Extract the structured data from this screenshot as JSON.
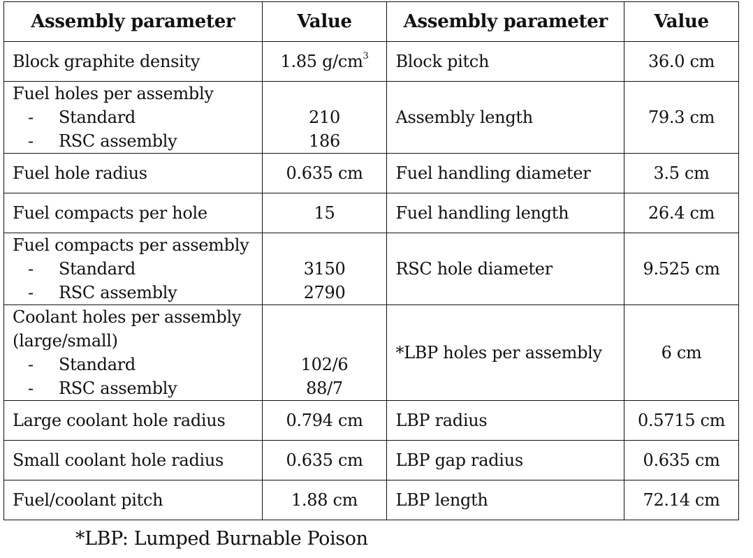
{
  "table": {
    "headers": [
      "Assembly parameter",
      "Value",
      "Assembly parameter",
      "Value"
    ],
    "rows": [
      {
        "left": {
          "param": "Block graphite density",
          "value": "1.85 g/cm",
          "value_sup": "3"
        },
        "right": {
          "param": "Block pitch",
          "value": "36.0 cm"
        }
      },
      {
        "left": {
          "param": "Fuel holes per assembly",
          "sub": [
            {
              "dash": "-",
              "label": "Standard",
              "value": "210"
            },
            {
              "dash": "-",
              "label": "RSC assembly",
              "value": "186"
            }
          ]
        },
        "right": {
          "param": "Assembly length",
          "value": "79.3 cm"
        }
      },
      {
        "left": {
          "param": "Fuel hole radius",
          "value": "0.635 cm"
        },
        "right": {
          "param": "Fuel handling diameter",
          "value": "3.5 cm"
        }
      },
      {
        "left": {
          "param": "Fuel compacts per hole",
          "value": "15"
        },
        "right": {
          "param": "Fuel handling length",
          "value": "26.4 cm"
        }
      },
      {
        "left": {
          "param": "Fuel compacts per assembly",
          "sub": [
            {
              "dash": "-",
              "label": "Standard",
              "value": "3150"
            },
            {
              "dash": "-",
              "label": "RSC assembly",
              "value": "2790"
            }
          ]
        },
        "right": {
          "param": "RSC hole diameter",
          "value": "9.525 cm"
        }
      },
      {
        "left": {
          "param": "Coolant holes per assembly",
          "param_line2": "(large/small)",
          "sub": [
            {
              "dash": "-",
              "label": "Standard",
              "value": "102/6"
            },
            {
              "dash": "-",
              "label": "RSC assembly",
              "value": "88/7"
            }
          ]
        },
        "right": {
          "param": "*LBP holes per assembly",
          "value": "6 cm"
        }
      },
      {
        "left": {
          "param": "Large coolant hole radius",
          "value": "0.794 cm"
        },
        "right": {
          "param": "LBP radius",
          "value": "0.5715 cm"
        }
      },
      {
        "left": {
          "param": "Small coolant hole radius",
          "value": "0.635 cm"
        },
        "right": {
          "param": "LBP gap radius",
          "value": "0.635 cm"
        }
      },
      {
        "left": {
          "param": "Fuel/coolant pitch",
          "value": "1.88 cm"
        },
        "right": {
          "param": "LBP length",
          "value": "72.14 cm"
        }
      }
    ]
  },
  "footnote": "*LBP: Lumped Burnable Poison"
}
